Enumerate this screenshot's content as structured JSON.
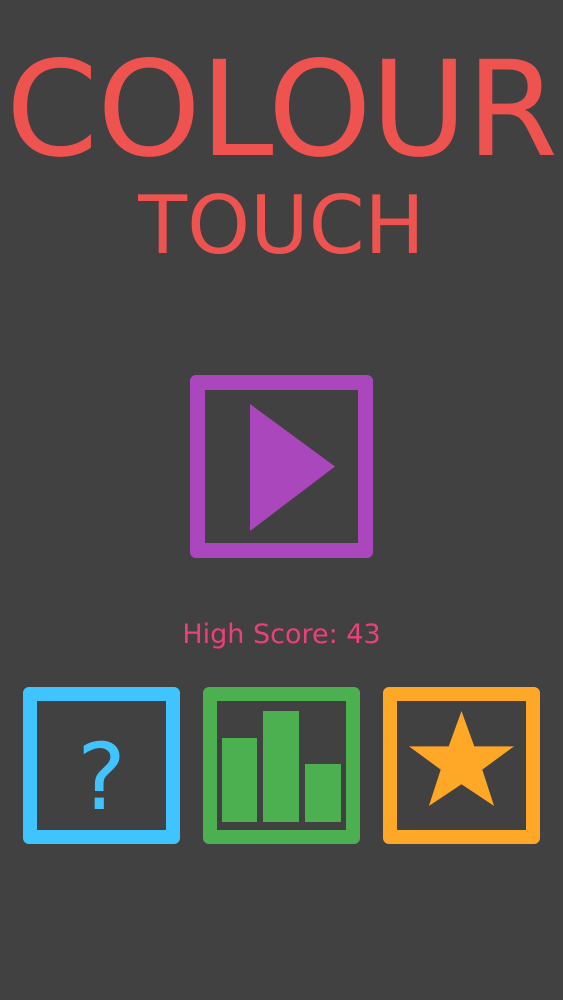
{
  "title": {
    "line1": "COLOUR",
    "line2": "TOUCH"
  },
  "play_button": {
    "icon": "play-icon",
    "color": "#ab47bc"
  },
  "high_score": {
    "label": "High Score: 43"
  },
  "bottom_buttons": {
    "help": {
      "icon": "question-mark-icon",
      "glyph": "?",
      "color": "#40c4ff"
    },
    "stats": {
      "icon": "bar-chart-icon",
      "color": "#4caf50"
    },
    "rate": {
      "icon": "star-icon",
      "color": "#ffa726"
    }
  },
  "colors": {
    "background": "#424141",
    "title": "#ef5350",
    "high_score": "#ec407a"
  }
}
